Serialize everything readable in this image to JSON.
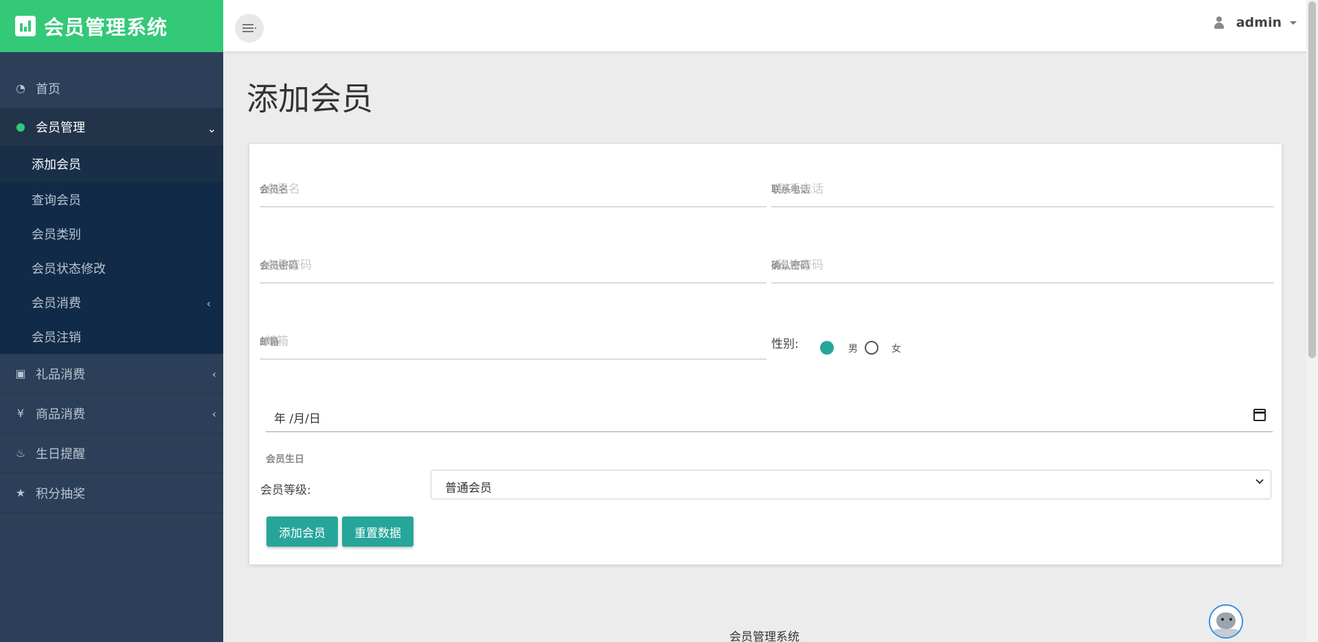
{
  "app": {
    "title": "会员管理系统"
  },
  "header": {
    "user": "admin"
  },
  "sidebar": {
    "items": [
      {
        "label": "首页",
        "icon": "dashboard-icon"
      },
      {
        "label": "会员管理",
        "icon": "user-icon",
        "active": true,
        "expanded": true
      },
      {
        "label": "礼品消费",
        "icon": "gift-icon"
      },
      {
        "label": "商品消费",
        "icon": "yen-icon"
      },
      {
        "label": "生日提醒",
        "icon": "birthday-cake-icon"
      },
      {
        "label": "积分抽奖",
        "icon": "star-icon"
      }
    ],
    "submenu": [
      {
        "label": "添加会员",
        "current": true
      },
      {
        "label": "查询会员"
      },
      {
        "label": "会员类别"
      },
      {
        "label": "会员状态修改"
      },
      {
        "label": "会员消费"
      },
      {
        "label": "会员注销"
      }
    ]
  },
  "page": {
    "title": "添加会员"
  },
  "form": {
    "member_name": {
      "label": "会员名",
      "placeholder": "会员名"
    },
    "phone": {
      "label": "联系电话",
      "placeholder": "联系电话"
    },
    "password": {
      "label": "会员密码",
      "placeholder": "会员密码"
    },
    "confirm_password": {
      "label": "确认密码",
      "placeholder": "确认密码"
    },
    "email": {
      "label": "邮箱",
      "placeholder": "邮箱"
    },
    "gender": {
      "label": "性别:",
      "options": [
        "男",
        "女"
      ],
      "selected": "男"
    },
    "birthday": {
      "value": "年 /月/日",
      "label": "会员生日"
    },
    "level": {
      "label": "会员等级:",
      "value": "普通会员"
    },
    "submit_label": "添加会员",
    "reset_label": "重置数据"
  },
  "footer": {
    "text": "会员管理系统"
  },
  "colors": {
    "brand": "#33c978",
    "sidebar": "#2c3f58",
    "submenu": "#112a47",
    "accent": "#26a69a"
  }
}
